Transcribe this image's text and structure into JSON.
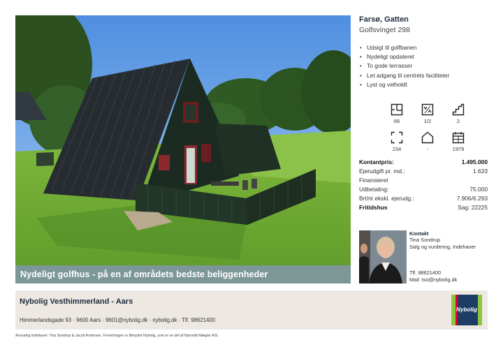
{
  "hero": {
    "caption": "Nydeligt golfhus - på en af områdets bedste beliggenheder"
  },
  "listing": {
    "title": "Farsø, Gatten",
    "address": "Golfsvinget 298",
    "features": [
      "Udsigt til golfbanen",
      "Nydeligt opdateret",
      "To gode terrasser",
      "Let adgang til centrets faciliteter",
      "Lyst og velholdt"
    ],
    "facts": [
      {
        "icon": "floor-plan-icon",
        "value": "66"
      },
      {
        "icon": "rooms-icon",
        "value": "1/2"
      },
      {
        "icon": "stairs-icon",
        "value": "2"
      },
      {
        "icon": "area-expand-icon",
        "value": "234"
      },
      {
        "icon": "house-icon",
        "value": "-"
      },
      {
        "icon": "calendar-icon",
        "value": "1979"
      }
    ]
  },
  "price": {
    "rows": [
      {
        "label": "Kontantpris:",
        "value": "1.495.000",
        "bold": true
      },
      {
        "label": "Ejerudgift pr. md.:",
        "value": "1.633",
        "bold": false
      },
      {
        "label": "Finansieret",
        "value": "",
        "bold": false
      },
      {
        "label": "Udbetaling:",
        "value": "75.000",
        "bold": false
      },
      {
        "label": "Brt/nt ekskl. ejerudg.:",
        "value": "7.906/6.293",
        "bold": false
      }
    ],
    "category_label": "Fritidshus",
    "case_number": "Sag: 22225"
  },
  "contact": {
    "heading": "Kontakt",
    "name": "Tina Sondrup",
    "role": "Salg og vurdering, Indehaver",
    "phone": "Tlf. 98621400",
    "email": "Mail: tso@nybolig.dk"
  },
  "office": {
    "name": "Nybolig Vesthimmerland - Aars",
    "contact_line": "Himmerlandsgade 93 · 9600 Aars · 9601@nybolig.dk · nybolig.dk · Tlf. 98621400",
    "logo_text": "Nybolig"
  },
  "legal": "Ansvarlig indehaver: Tina Sondrup & Jacob Andersen. Forretningen er tilknyttet Nybolig, som er en del af Nykredit Mægler A/S.",
  "colors": {
    "navy": "#1e3c64",
    "band": "#ede8e2",
    "logo_green": "#8cc63f",
    "logo_red": "#e4002b"
  }
}
